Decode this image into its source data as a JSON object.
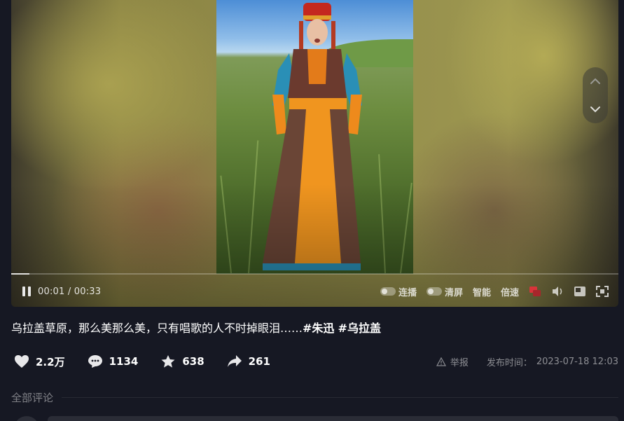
{
  "player": {
    "time_current": "00:01",
    "time_separator": "/",
    "time_total": "00:33",
    "progress": 0.03,
    "controls": {
      "continuous_play": "连播",
      "clear_screen": "清屏",
      "smart": "智能",
      "speed": "倍速"
    }
  },
  "description": {
    "text": "乌拉盖草原，那么美那么美，只有唱歌的人不时掉眼泪……",
    "hashtags": [
      "#朱迅",
      "#乌拉盖"
    ]
  },
  "stats": {
    "likes": "2.2万",
    "comments": "1134",
    "favorites": "638",
    "shares": "261"
  },
  "meta": {
    "report": "举报",
    "publish_label": "发布时间：",
    "publish_time": "2023-07-18 12:03"
  },
  "comments": {
    "header": "全部评论"
  },
  "icons": [
    "pause-icon",
    "up-arrow-icon",
    "down-arrow-icon",
    "danmaku-icon",
    "volume-icon",
    "pip-icon",
    "fullscreen-icon",
    "heart-icon",
    "comment-icon",
    "star-icon",
    "share-icon",
    "warning-icon"
  ]
}
